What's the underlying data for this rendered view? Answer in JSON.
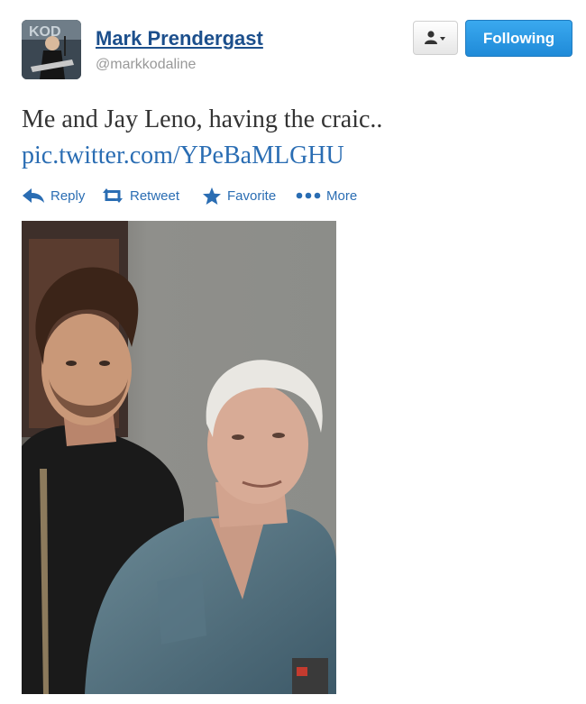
{
  "tweet": {
    "author_name": "Mark Prendergast",
    "author_handle": "@markkodaline",
    "text": "Me and Jay Leno, having the craic..",
    "link": "pic.twitter.com/YPeBaMLGHU"
  },
  "buttons": {
    "following_label": "Following",
    "user_menu_icon": "person-with-dropdown-icon"
  },
  "actions": [
    {
      "label": "Reply",
      "icon": "reply-arrow-icon"
    },
    {
      "label": "Retweet",
      "icon": "retweet-icon"
    },
    {
      "label": "Favorite",
      "icon": "star-icon"
    },
    {
      "label": "More",
      "icon": "dots-icon"
    }
  ],
  "colors": {
    "link": "#2a6db3",
    "name": "#1c4f8c",
    "following_button": "#2a95e3"
  }
}
